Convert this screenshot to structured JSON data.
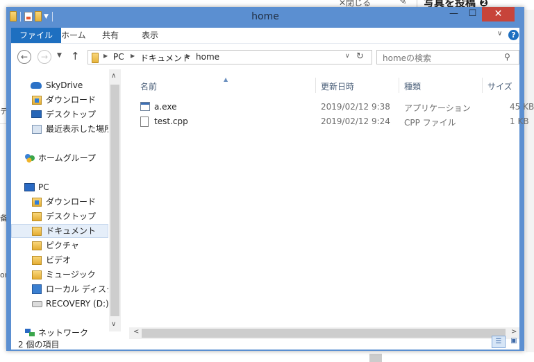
{
  "background": {
    "close_label": "✕閉じる",
    "post_label": "写真を投稿 ❷",
    "fragments": [
      "テ",
      "备",
      "or"
    ]
  },
  "window": {
    "title": "home",
    "minimize_glyph": "—",
    "maximize_glyph": "☐",
    "close_glyph": "✕"
  },
  "ribbon": {
    "tabs": [
      "ファイル",
      "ホーム",
      "共有",
      "表示"
    ],
    "help_glyph": "?"
  },
  "address": {
    "crumbs": [
      "PC",
      "ドキュメント",
      "home"
    ],
    "search_placeholder": "homeの検索"
  },
  "navpane": {
    "items": [
      {
        "label": "SkyDrive",
        "icon": "cloud-icon"
      },
      {
        "label": "ダウンロード",
        "icon": "downloads-folder-icon"
      },
      {
        "label": "デスクトップ",
        "icon": "desktop-icon"
      },
      {
        "label": "最近表示した場所",
        "icon": "recent-places-icon"
      },
      {
        "label": "ホームグループ",
        "icon": "homegroup-icon"
      },
      {
        "label": "PC",
        "icon": "pc-icon"
      },
      {
        "label": "ダウンロード",
        "icon": "downloads-folder-icon"
      },
      {
        "label": "デスクトップ",
        "icon": "desktop-folder-icon"
      },
      {
        "label": "ドキュメント",
        "icon": "documents-folder-icon"
      },
      {
        "label": "ピクチャ",
        "icon": "pictures-folder-icon"
      },
      {
        "label": "ビデオ",
        "icon": "videos-folder-icon"
      },
      {
        "label": "ミュージック",
        "icon": "music-folder-icon"
      },
      {
        "label": "ローカル ディスク (C",
        "icon": "local-disk-icon"
      },
      {
        "label": "RECOVERY (D:)",
        "icon": "drive-icon"
      },
      {
        "label": "ネットワーク",
        "icon": "network-icon"
      }
    ],
    "selected": "ドキュメント"
  },
  "filelist": {
    "columns": [
      "名前",
      "更新日時",
      "種類",
      "サイズ"
    ],
    "rows": [
      {
        "name": "a.exe",
        "date": "2019/02/12 9:38",
        "type": "アプリケーション",
        "size": "45 KB"
      },
      {
        "name": "test.cpp",
        "date": "2019/02/12 9:24",
        "type": "CPP ファイル",
        "size": "1 KB"
      }
    ]
  },
  "status": {
    "item_count": "2 個の項目"
  }
}
